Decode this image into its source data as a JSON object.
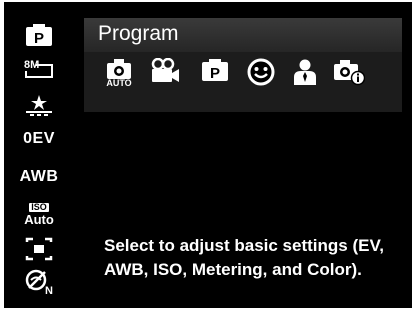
{
  "panel": {
    "title": "Program",
    "modes": [
      {
        "icon": "auto-camera-icon",
        "sublabel": "AUTO"
      },
      {
        "icon": "movie-camera-icon"
      },
      {
        "icon": "program-p-icon"
      },
      {
        "icon": "smile-face-icon"
      },
      {
        "icon": "portrait-person-icon"
      },
      {
        "icon": "camera-info-icon"
      }
    ]
  },
  "sidebar": {
    "items": [
      {
        "icon": "program-p-icon"
      },
      {
        "icon": "resolution-8m-icon",
        "label": "8M"
      },
      {
        "icon": "quality-stars-icon"
      },
      {
        "icon": "exposure-icon",
        "label": "0EV"
      },
      {
        "icon": "white-balance-icon",
        "label": "AWB"
      },
      {
        "icon": "iso-icon",
        "label_box": "ISO",
        "label": "Auto"
      },
      {
        "icon": "metering-icon"
      },
      {
        "icon": "color-icon",
        "label": "N"
      }
    ]
  },
  "description": {
    "text": "Select to adjust basic settings (EV, AWB, ISO, Metering, and Color)."
  },
  "colors": {
    "background": "#000000",
    "panel": "#1c1c1c",
    "title_bar": "#2e2e2e",
    "text": "#ffffff"
  }
}
